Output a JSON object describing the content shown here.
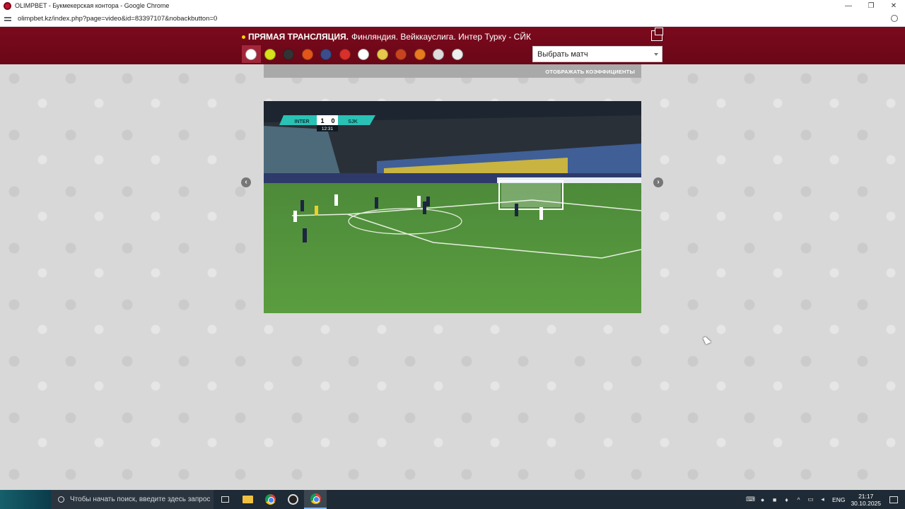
{
  "browser": {
    "tab_title": "OLIMPBET - Букмекерская контора - Google Chrome",
    "url": "olimpbet.kz/index.php?page=video&id=83397107&nobackbutton=0",
    "window_buttons": {
      "minimize": "—",
      "restore": "❐",
      "close": "✕"
    }
  },
  "header": {
    "live_label": "ПРЯМАЯ ТРАНСЛЯЦИЯ.",
    "match_title": "Финляндия. Вейккауслига. Интер Турку - СЙК",
    "match_select": "Выбрать матч",
    "sports": [
      {
        "icon": "soccer-icon",
        "color": "#ffffff",
        "active": true
      },
      {
        "icon": "tennis-icon",
        "color": "#d6e21a"
      },
      {
        "icon": "hockey-puck-icon",
        "color": "#333333"
      },
      {
        "icon": "basketball-icon",
        "color": "#e2561b"
      },
      {
        "icon": "american-football-icon",
        "color": "#3b4d8c"
      },
      {
        "icon": "table-tennis-icon",
        "color": "#d8302a"
      },
      {
        "icon": "futsal-icon",
        "color": "#ffffff"
      },
      {
        "icon": "volleyball-icon",
        "color": "#e6c84a"
      },
      {
        "icon": "rugby-helmet-icon",
        "color": "#c8441f"
      },
      {
        "icon": "handball-icon",
        "color": "#e87a1f"
      },
      {
        "icon": "darts-icon",
        "color": "#dddddd"
      },
      {
        "icon": "badminton-icon",
        "color": "#eeeeee"
      }
    ]
  },
  "player": {
    "odds_toggle": "ОТОБРАЖАТЬ КОЭФФИЦИЕНТЫ",
    "prev": "‹",
    "next": "›",
    "scoreboard": {
      "home": "INTER",
      "home_score": "1",
      "away_score": "0",
      "away": "SJK",
      "time": "12:31"
    }
  },
  "taskbar": {
    "search_placeholder": "Чтобы начать поиск, введите здесь запрос",
    "lang": "ENG",
    "time": "21:17",
    "date": "30.10.2025"
  }
}
